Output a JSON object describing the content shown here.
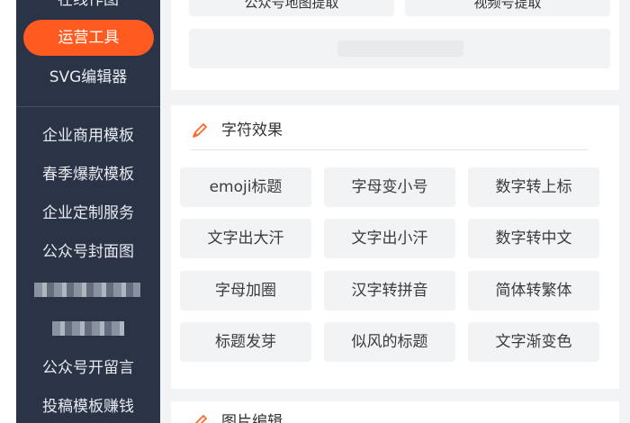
{
  "sidebar": {
    "top_partial": "在线作图",
    "active_item": "运营工具",
    "items": [
      "SVG编辑器",
      "企业商用模板",
      "春季爆款模板",
      "企业定制服务",
      "公众号封面图",
      "公众号开留言",
      "投稿模板赚钱"
    ]
  },
  "top_card": {
    "buttons": [
      "公众号地图提取",
      "视频号提取"
    ]
  },
  "section": {
    "title": "字符效果",
    "tiles": [
      "emoji标题",
      "字母变小号",
      "数字转上标",
      "文字出大汗",
      "文字出小汗",
      "数字转中文",
      "字母加圈",
      "汉字转拼音",
      "简体转繁体",
      "标题发芽",
      "似风的标题",
      "文字渐变色"
    ]
  },
  "bottom_section": {
    "title": "图片编辑"
  },
  "colors": {
    "sidebar_bg": "#2a3446",
    "active": "#ff5a1f",
    "icon": "#ff6a2b",
    "tile_bg": "#f2f3f5"
  },
  "icons": {
    "section": "pencil-icon"
  }
}
